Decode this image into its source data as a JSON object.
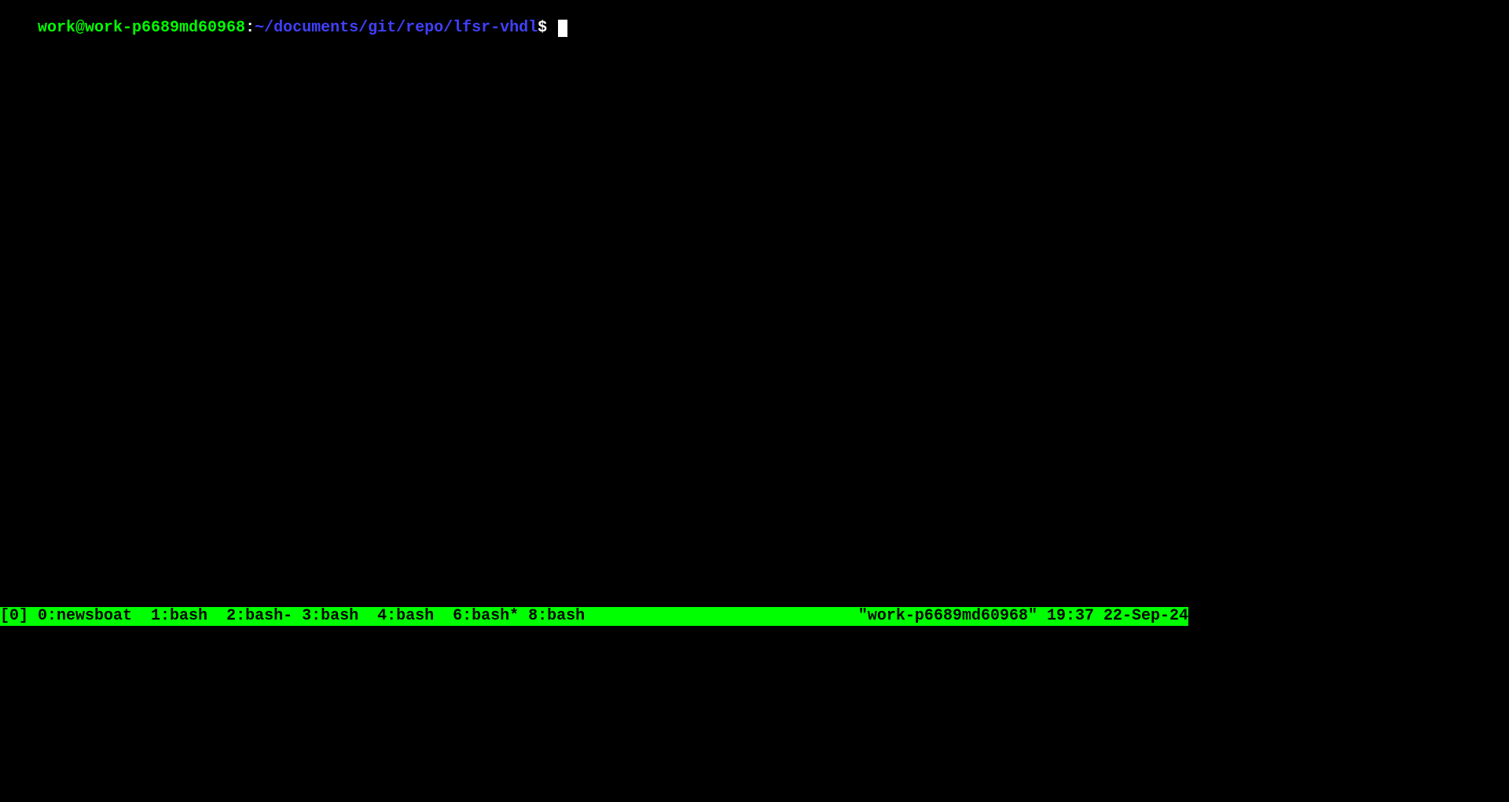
{
  "prompt": {
    "user_host": "work@work-p6689md60968",
    "separator": ":",
    "path": "~/documents/git/repo/lfsr-vhdl",
    "symbol": "$ "
  },
  "status_bar": {
    "session": "[0] ",
    "windows": [
      {
        "label": "0:newsboat  "
      },
      {
        "label": "1:bash  "
      },
      {
        "label": "2:bash- "
      },
      {
        "label": "3:bash  "
      },
      {
        "label": "4:bash  "
      },
      {
        "label": "6:bash* "
      },
      {
        "label": "8:bash"
      }
    ],
    "hostname": "\"work-p6689md60968\" ",
    "datetime": "19:37 22-Sep-24"
  }
}
